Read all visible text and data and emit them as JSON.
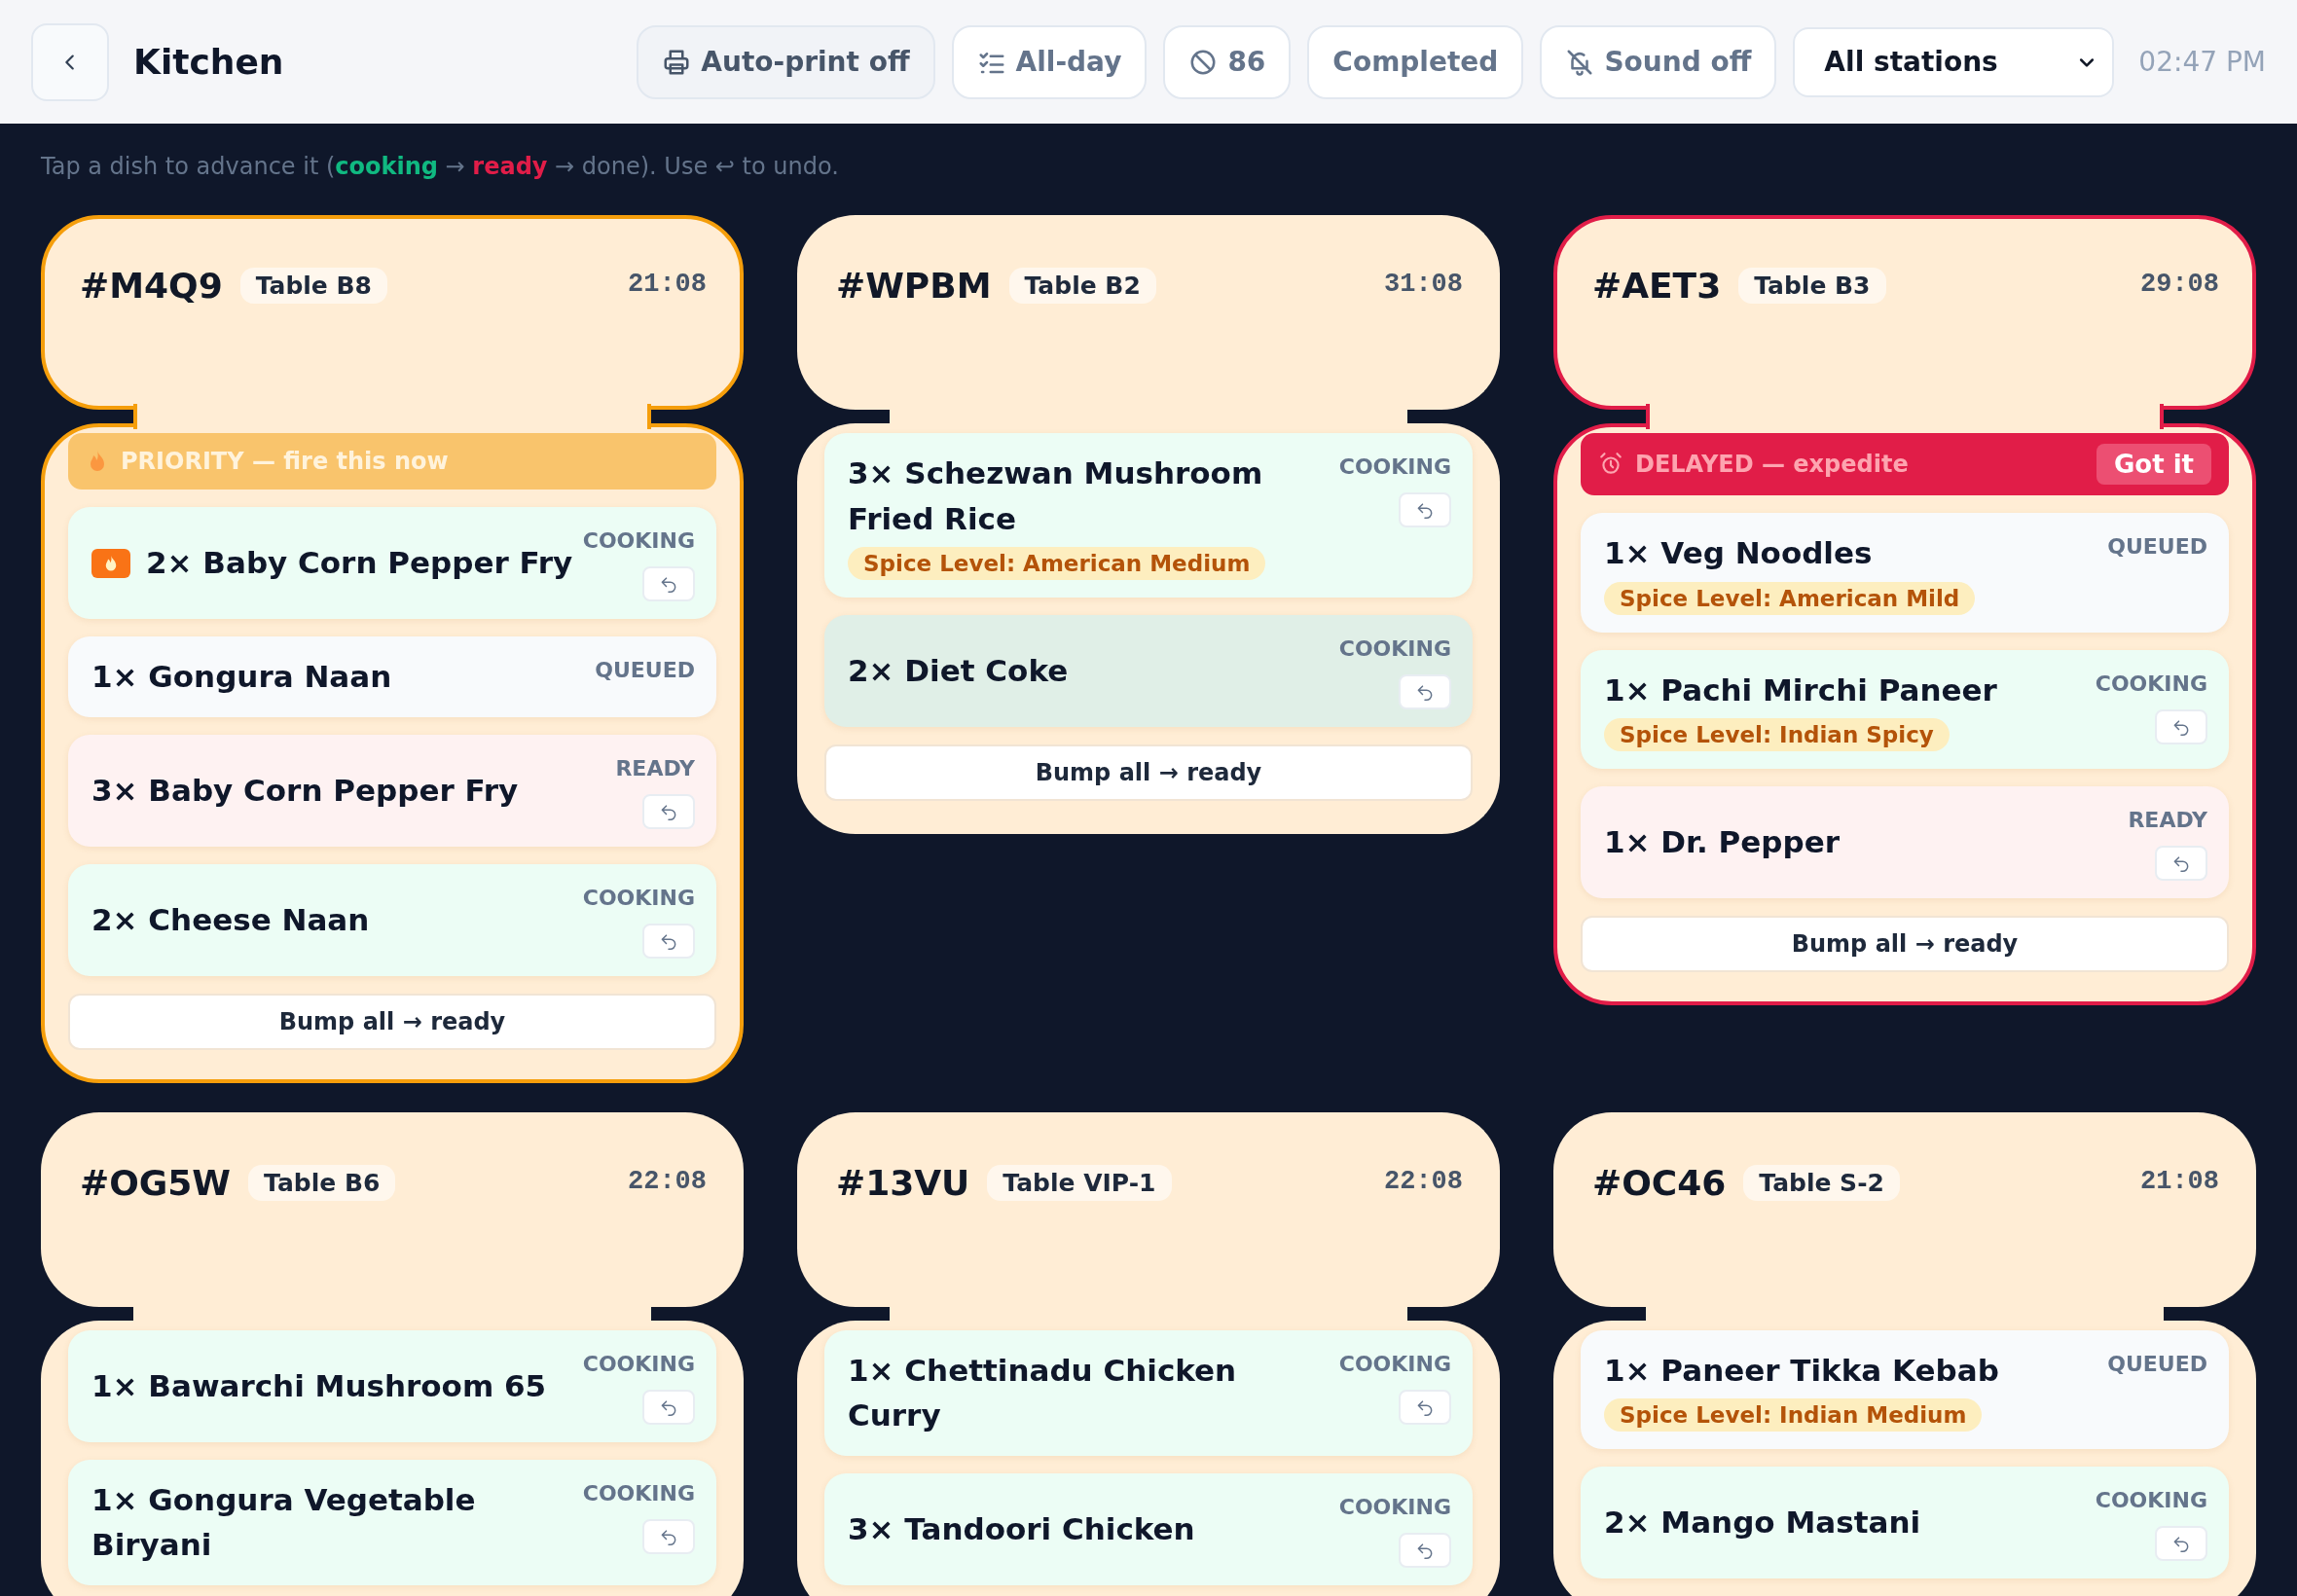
{
  "header": {
    "title": "Kitchen",
    "buttons": [
      "Auto-print off",
      "All-day",
      "86",
      "Completed",
      "Sound off"
    ],
    "station_select": "All stations",
    "clock": "02:47 PM"
  },
  "hint": "Tap a dish to advance it (**cooking** → **ready** → done). Use ↩ to undo.",
  "tickets": [
    {
      "order": "#M4Q9",
      "table": "Table B8",
      "time": "21:08",
      "banner": {
        "kind": "priority",
        "text": "PRIORITY — fire this now"
      },
      "items": [
        {
          "name": "2× Baby Corn Pepper Fry",
          "status": "COOKING",
          "fire": true,
          "highlighted": false
        },
        {
          "name": "1× Gongura Naan",
          "status": "QUEUED",
          "fire": false,
          "highlighted": false
        },
        {
          "name": "3× Baby Corn Pepper Fry",
          "status": "READY",
          "fire": false,
          "highlighted": false
        },
        {
          "name": "2× Cheese Naan",
          "status": "COOKING",
          "fire": false,
          "highlighted": false
        }
      ],
      "bump": "Bump all → ready"
    },
    {
      "order": "#WPBM",
      "table": "Table B2",
      "time": "31:08",
      "items": [
        {
          "name": "3× Schezwan Mushroom Fried Rice",
          "status": "COOKING",
          "spice": "Spice Level: American Medium",
          "fire": false,
          "highlighted": false
        },
        {
          "name": "2× Diet Coke",
          "status": "COOKING",
          "fire": false,
          "highlighted": true
        }
      ],
      "bump": "Bump all → ready"
    },
    {
      "order": "#AET3",
      "table": "Table B3",
      "time": "29:08",
      "banner": {
        "kind": "delayed",
        "text": "DELAYED — expedite",
        "action": "Got it"
      },
      "items": [
        {
          "name": "1× Veg Noodles",
          "status": "QUEUED",
          "spice": "Spice Level: American Mild",
          "fire": false,
          "highlighted": false
        },
        {
          "name": "1× Pachi Mirchi Paneer",
          "status": "COOKING",
          "spice": "Spice Level: Indian Spicy",
          "fire": false,
          "highlighted": false
        },
        {
          "name": "1× Dr. Pepper",
          "status": "READY",
          "fire": false,
          "highlighted": false
        }
      ],
      "bump": "Bump all → ready"
    },
    {
      "order": "#OG5W",
      "table": "Table B6",
      "time": "22:08",
      "items": [
        {
          "name": "1× Bawarchi Mushroom 65",
          "status": "COOKING",
          "fire": false,
          "highlighted": false
        },
        {
          "name": "1× Gongura Vegetable Biryani",
          "status": "COOKING",
          "fire": false,
          "highlighted": false
        }
      ]
    },
    {
      "order": "#13VU",
      "table": "Table VIP-1",
      "time": "22:08",
      "items": [
        {
          "name": "1× Chettinadu Chicken Curry",
          "status": "COOKING",
          "fire": false,
          "highlighted": false
        },
        {
          "name": "3× Tandoori Chicken",
          "status": "COOKING",
          "fire": false,
          "highlighted": false
        }
      ]
    },
    {
      "order": "#OC46",
      "table": "Table S-2",
      "time": "21:08",
      "items": [
        {
          "name": "1× Paneer Tikka Kebab",
          "status": "QUEUED",
          "spice": "Spice Level: Indian Medium",
          "fire": false,
          "highlighted": false
        },
        {
          "name": "2× Mango Mastani",
          "status": "COOKING",
          "fire": false,
          "highlighted": false
        }
      ]
    }
  ]
}
